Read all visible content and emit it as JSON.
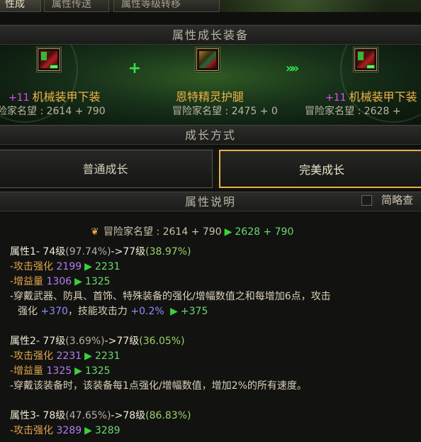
{
  "tabs": [
    {
      "label": "性成长"
    },
    {
      "label": "属性传送"
    },
    {
      "label": "属性等级转移"
    }
  ],
  "sections": {
    "equip_title": "属性成长装备",
    "method_title": "成长方式",
    "desc_title": "属性说明"
  },
  "equipment": {
    "source": {
      "level": "+11",
      "name": "机械装甲下装",
      "reputation": "险家名望 : 2614 + 790"
    },
    "material": {
      "name": "恩特精灵护腿",
      "reputation": "冒险家名望 : 2475 + 0"
    },
    "result": {
      "level": "+11",
      "name": "机械装甲下装",
      "reputation": "冒险家名望 : 2628 +"
    },
    "plus_symbol": "+",
    "arrow_symbol": "»»"
  },
  "methods": {
    "normal_label": "普通成长",
    "perfect_label": "完美成长",
    "selected": "perfect"
  },
  "brief_view": {
    "label": "简略查",
    "checked": false
  },
  "description": {
    "reputation": {
      "label": "冒险家名望 : 2614 + 790",
      "new": "2628 + 790"
    },
    "attr1": {
      "head": "属性1- 74级",
      "pct": "(97.74%)",
      "arrow": "->77级",
      "new_pct": "(38.97%)",
      "atk_label": "-攻击强化",
      "atk_old": "2199",
      "atk_new": "2231",
      "gain_label": "-增益量",
      "gain_old": "1306",
      "gain_new": "1325",
      "note_line1": "-穿戴武器、防具、首饰、特殊装备的强化/增幅数值之和每增加6点，攻击",
      "note_line2_a": "强化",
      "note_line2_b": "+370",
      "note_line2_c": "，技能攻击力",
      "note_line2_d": "+0.2%",
      "note_line2_e": "+375"
    },
    "attr2": {
      "head": "属性2- 77级",
      "pct": "(3.69%)",
      "arrow": "->77级",
      "new_pct": "(36.05%)",
      "atk_label": "-攻击强化",
      "atk_old": "2231",
      "atk_new": "2231",
      "gain_label": "-增益量",
      "gain_old": "1325",
      "gain_new": "1325",
      "note": "-穿戴该装备时，该装备每1点强化/增幅数值，增加2%的所有速度。"
    },
    "attr3": {
      "head": "属性3- 78级",
      "pct": "(47.65%)",
      "arrow": "->78级",
      "new_pct": "(86.83%)",
      "atk_label": "-攻击强化",
      "atk_old": "3289",
      "atk_new": "3289"
    }
  },
  "colors": {
    "accent_gold": "#e2b548",
    "green": "#3bd13b",
    "purple": "#b27df0",
    "orange": "#e0a44a"
  },
  "icons": [
    "mech-armor-pants-icon",
    "ent-elf-leggings-icon",
    "reputation-emblem-icon",
    "triangle-arrow-icon"
  ]
}
